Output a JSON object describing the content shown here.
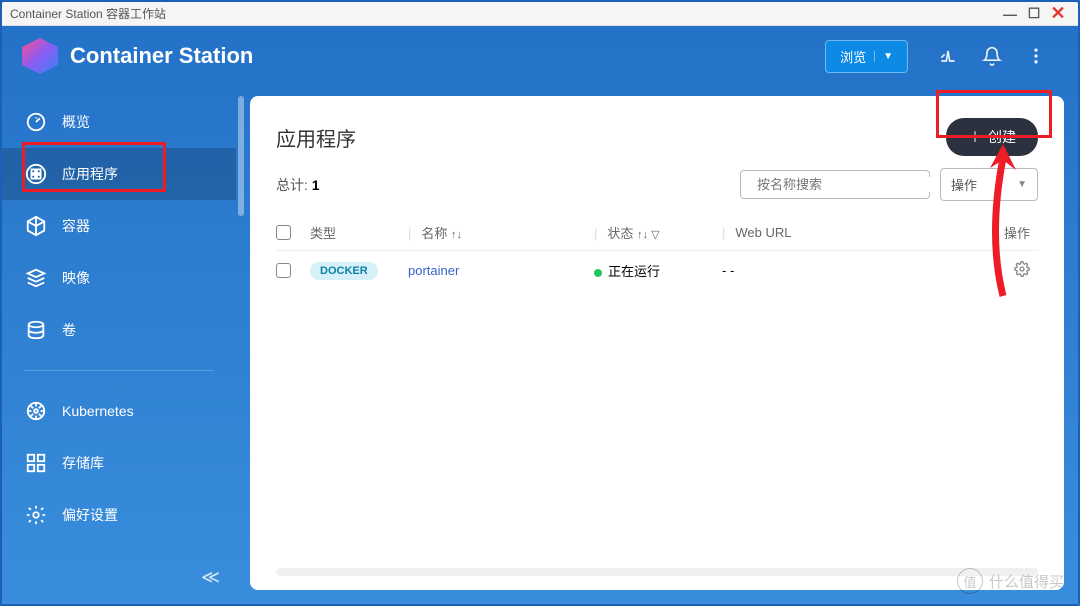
{
  "window": {
    "title": "Container Station 容器工作站"
  },
  "header": {
    "app_title": "Container Station",
    "browse_label": "浏览"
  },
  "sidebar": {
    "items": [
      {
        "label": "概览",
        "icon": "gauge-icon"
      },
      {
        "label": "应用程序",
        "icon": "apps-icon"
      },
      {
        "label": "容器",
        "icon": "cube-icon"
      },
      {
        "label": "映像",
        "icon": "layers-icon"
      },
      {
        "label": "卷",
        "icon": "database-icon"
      }
    ],
    "items2": [
      {
        "label": "Kubernetes",
        "icon": "helm-icon"
      },
      {
        "label": "存储库",
        "icon": "grid-icon"
      },
      {
        "label": "偏好设置",
        "icon": "gear-icon"
      }
    ]
  },
  "panel": {
    "title": "应用程序",
    "create_label": "创建",
    "total_label": "总计:",
    "total_value": "1",
    "search_placeholder": "按名称搜索",
    "action_label": "操作",
    "columns": {
      "type": "类型",
      "name": "名称",
      "status": "状态",
      "url": "Web URL",
      "actions": "操作"
    },
    "rows": [
      {
        "type": "DOCKER",
        "name": "portainer",
        "status": "正在运行",
        "url": "- -"
      }
    ]
  },
  "watermark": {
    "badge": "值",
    "text": "什么值得买"
  }
}
